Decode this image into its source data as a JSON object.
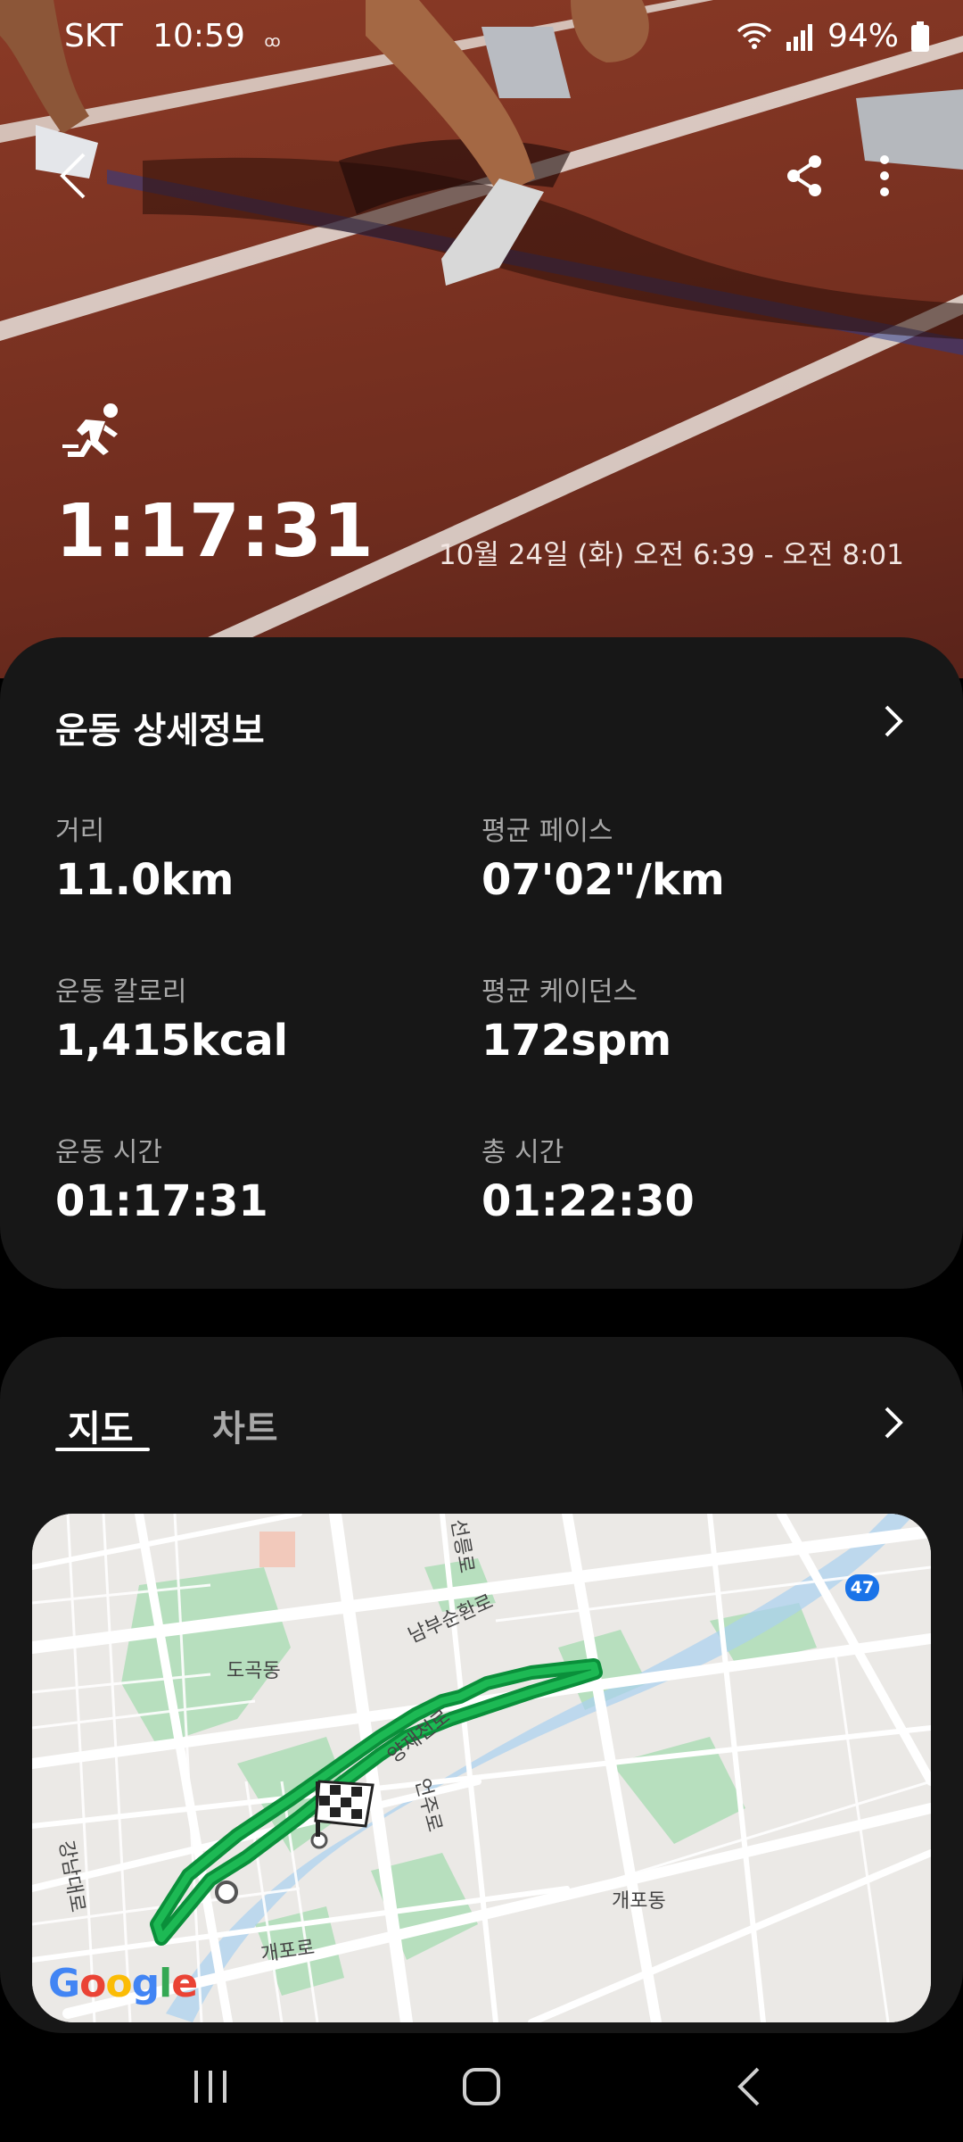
{
  "status": {
    "carrier": "SKT",
    "time": "10:59",
    "extra": "ꝏ",
    "battery": "94%"
  },
  "hero": {
    "duration": "1:17:31",
    "date_range": "10월 24일 (화) 오전 6:39 - 오전 8:01"
  },
  "details": {
    "title": "운동 상세정보",
    "stats": [
      {
        "label": "거리",
        "value": "11.0km"
      },
      {
        "label": "평균 페이스",
        "value": "07'02\"/km"
      },
      {
        "label": "운동 칼로리",
        "value": "1,415kcal"
      },
      {
        "label": "평균 케이던스",
        "value": "172spm"
      },
      {
        "label": "운동 시간",
        "value": "01:17:31"
      },
      {
        "label": "총 시간",
        "value": "01:22:30"
      }
    ]
  },
  "map_section": {
    "tabs": [
      "지도",
      "차트"
    ],
    "active_tab": "지도",
    "labels": {
      "dogok": "도곡동",
      "gaepo": "개포동",
      "nambu": "남부순환로",
      "yangjae": "양재천로",
      "eonju": "언주로",
      "gaeporo": "개포로",
      "gangnam": "강남대로",
      "seolleung": "선릉로"
    },
    "route_number": "47",
    "attribution": "Google"
  },
  "colors": {
    "card_bg": "#171717",
    "route_green": "#1db954",
    "accent_white": "#ffffff"
  },
  "icons": {
    "back": "back-arrow-icon",
    "share": "share-icon",
    "more": "more-vertical-icon",
    "runner": "running-icon",
    "chevron": "chevron-right-icon",
    "finish": "finish-flag-icon"
  }
}
